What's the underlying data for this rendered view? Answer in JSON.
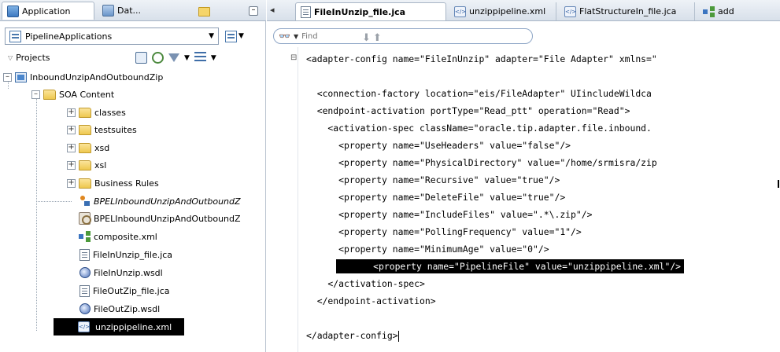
{
  "left_panel": {
    "tabs": [
      {
        "label": "Application"
      },
      {
        "label": "Dat..."
      }
    ],
    "application_select": "PipelineApplications",
    "projects_label": "Projects",
    "tree": {
      "project": "InboundUnzipAndOutboundZip",
      "soa_content": "SOA Content",
      "folders": [
        "classes",
        "testsuites",
        "xsd",
        "xsl",
        "Business Rules"
      ],
      "files": [
        {
          "label": "BPELInboundUnzipAndOutboundZ",
          "icon": "bpel-process-icon",
          "italic": true
        },
        {
          "label": "BPELInboundUnzipAndOutboundZ",
          "icon": "bpel-file-icon",
          "italic": false
        },
        {
          "label": "composite.xml",
          "icon": "composite-icon",
          "italic": false
        },
        {
          "label": "FileInUnzip_file.jca",
          "icon": "jca-file-icon",
          "italic": false
        },
        {
          "label": "FileInUnzip.wsdl",
          "icon": "wsdl-icon",
          "italic": false
        },
        {
          "label": "FileOutZip_file.jca",
          "icon": "jca-file-icon",
          "italic": false
        },
        {
          "label": "FileOutZip.wsdl",
          "icon": "wsdl-icon",
          "italic": false
        },
        {
          "label": "unzippipeline.xml",
          "icon": "xml-file-icon",
          "italic": false,
          "selected": true
        }
      ]
    }
  },
  "editor": {
    "tabs": [
      {
        "label": "FileInUnzip_file.jca",
        "active": true
      },
      {
        "label": "unzippipeline.xml",
        "active": false
      },
      {
        "label": "FlatStructureIn_file.jca",
        "active": false
      },
      {
        "label": "add",
        "active": false
      }
    ],
    "find_placeholder": "Find",
    "code_lines": [
      "<adapter-config name=\"FileInUnzip\" adapter=\"File Adapter\" xmlns=\"",
      "",
      "  <connection-factory location=\"eis/FileAdapter\" UIincludeWildca",
      "  <endpoint-activation portType=\"Read_ptt\" operation=\"Read\">",
      "    <activation-spec className=\"oracle.tip.adapter.file.inbound.",
      "      <property name=\"UseHeaders\" value=\"false\"/>",
      "      <property name=\"PhysicalDirectory\" value=\"/home/srmisra/zip",
      "      <property name=\"Recursive\" value=\"true\"/>",
      "      <property name=\"DeleteFile\" value=\"true\"/>",
      "      <property name=\"IncludeFiles\" value=\".*\\.zip\"/>",
      "      <property name=\"PollingFrequency\" value=\"1\"/>",
      "      <property name=\"MinimumAge\" value=\"0\"/>",
      "      <property name=\"PipelineFile\" value=\"unzippipeline.xml\"/>",
      "    </activation-spec>",
      "  </endpoint-activation>",
      "",
      "</adapter-config>"
    ]
  }
}
